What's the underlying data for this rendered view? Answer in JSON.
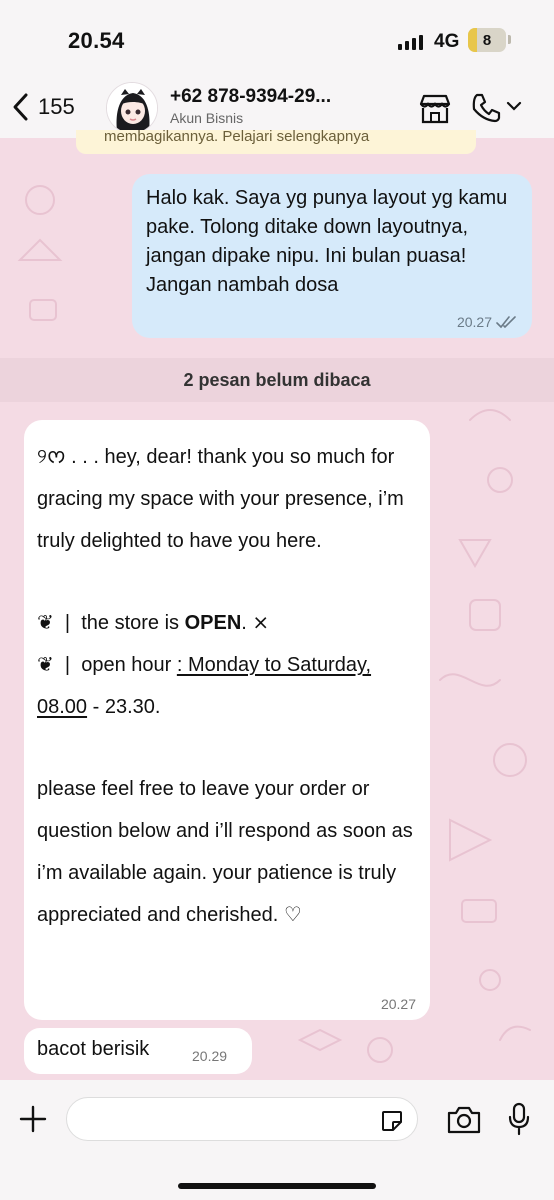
{
  "status_bar": {
    "time": "20.54",
    "network": "4G",
    "battery": "8"
  },
  "header": {
    "back_count": "155",
    "contact_name": "+62 878-9394-29...",
    "contact_subtitle": "Akun Bisnis",
    "icons": [
      "chevron-left-icon",
      "avatar",
      "store-icon",
      "phone-icon",
      "chevron-down-icon"
    ]
  },
  "pinned_banner": {
    "text": "membagikannya. Pelajari selengkapnya"
  },
  "outgoing_message": {
    "text": "Halo kak. Saya yg punya layout yg kamu pake. Tolong ditake down layoutnya, jangan dipake nipu. Ini bulan puasa! Jangan nambah dosa",
    "time": "20.27",
    "status": "double-check-icon"
  },
  "unread_banner": "2 pesan belum dibaca",
  "incoming_message_1": {
    "line_1": "୨ᰔ . . . hey, dear! thank you so much for gracing my space with your presence, i’m truly delighted to have you here.",
    "store_bullet": "❦",
    "store_sep": "|",
    "store_text": "the store is",
    "store_status": "OPEN",
    "store_suffix": ". ⨯",
    "hours_bullet": "❦",
    "hours_sep": "|",
    "hours_label": "open hour",
    "hours_value": ": Monday to Saturday, 08.00",
    "hours_end": " - 23.30.",
    "closing": "please feel free to leave your order or question below and i’ll respond as soon as i’m available again. your patience is truly appreciated and cherished. ♡",
    "time": "20.27"
  },
  "incoming_message_2": {
    "text": "bacot berisik",
    "time": "20.29"
  },
  "input_bar": {
    "icons": [
      "plus-icon",
      "sticker-icon",
      "camera-icon",
      "microphone-icon"
    ]
  },
  "colors": {
    "wallpaper": "#f4dbe4",
    "outgoing_bubble": "#d6eafa",
    "incoming_bubble": "#ffffff",
    "unread_banner": "#ecd3dc",
    "pinned_banner": "#fdf4d7"
  }
}
